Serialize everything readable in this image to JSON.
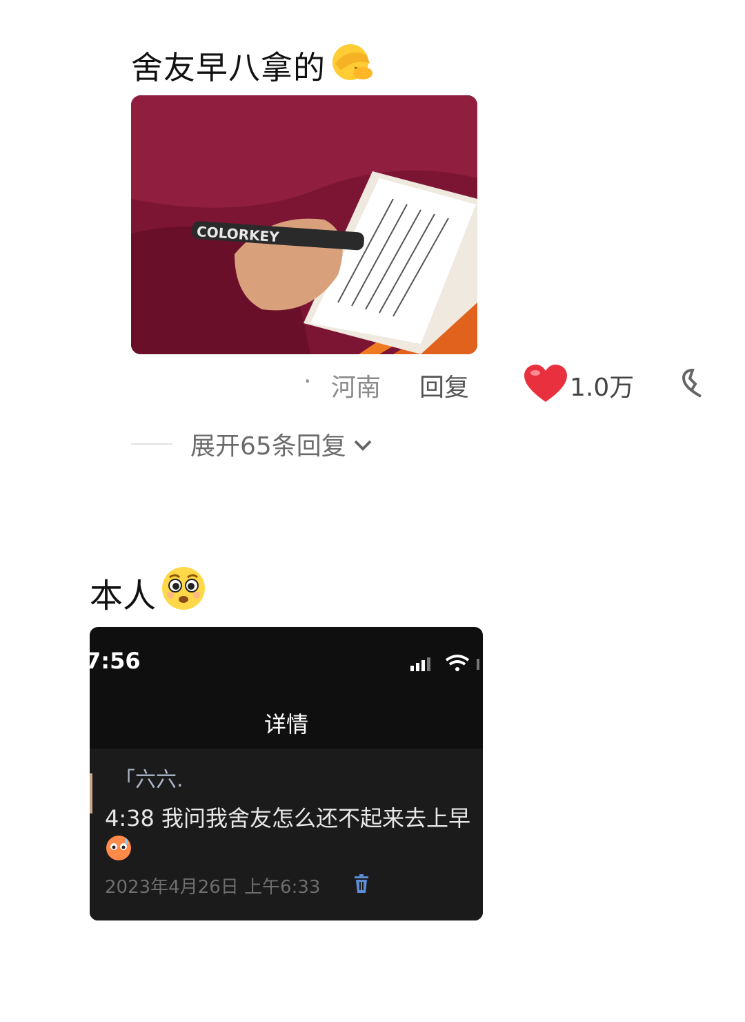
{
  "comment": {
    "text": "舍友早八拿的",
    "emoji": "facepalm-emoji",
    "location_dot": "·",
    "location": "河南",
    "reply_label": "回复",
    "likes": "1.0万",
    "expand_label": "展开65条回复"
  },
  "photo": {
    "brand_text": "COLORKEY"
  },
  "self_post": {
    "text": "本人",
    "emoji": "pleading-face-emoji"
  },
  "screenshot": {
    "time": "7:56",
    "title": "详情",
    "sender": "「六六.",
    "message": "4:38 我问我舍友怎么还不起来去上早",
    "date": "2023年4月26日 上午6:33"
  }
}
